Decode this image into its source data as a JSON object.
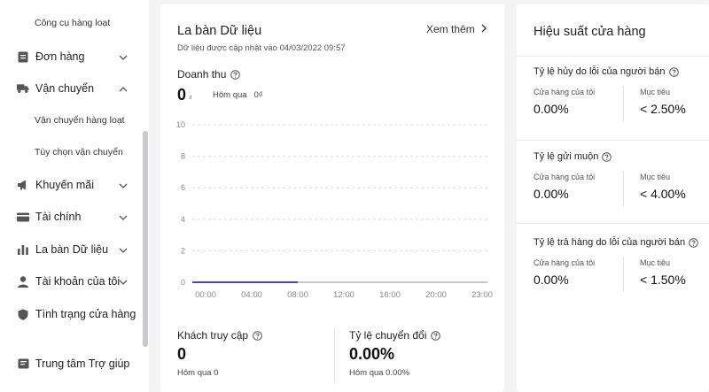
{
  "sidebar": {
    "items": [
      {
        "type": "sub",
        "label": "Công cụ hàng loạt"
      },
      {
        "type": "main",
        "label": "Đơn hàng",
        "icon": "order-icon",
        "chevron": "down"
      },
      {
        "type": "main",
        "label": "Vận chuyển",
        "icon": "truck-icon",
        "chevron": "up"
      },
      {
        "type": "sub",
        "label": "Vận chuyển hàng loạt"
      },
      {
        "type": "sub",
        "label": "Tùy chọn vận chuyển"
      },
      {
        "type": "main",
        "label": "Khuyến mãi",
        "icon": "megaphone-icon",
        "chevron": "down"
      },
      {
        "type": "main",
        "label": "Tài chính",
        "icon": "wallet-icon",
        "chevron": "down"
      },
      {
        "type": "main",
        "label": "La bàn Dữ liệu",
        "icon": "bar-chart-icon",
        "chevron": "down"
      },
      {
        "type": "main",
        "label": "Tài khoản của tôi",
        "icon": "user-icon",
        "chevron": "down"
      },
      {
        "type": "main",
        "label": "Tình trạng cửa hàng",
        "icon": "shield-icon"
      },
      {
        "type": "main",
        "label": "Trung tâm Trợ giúp",
        "icon": "help-center-icon"
      }
    ]
  },
  "data_compass": {
    "title": "La bàn Dữ liệu",
    "see_more": "Xem thêm",
    "updated": "Dữ liệu được cập nhật vào 04/03/2022 09:57",
    "revenue_label": "Doanh thu",
    "revenue_value": "0",
    "revenue_unit": "₫",
    "revenue_yesterday_label": "Hôm qua",
    "revenue_yesterday_value": "0₫",
    "visitors_label": "Khách truy cập",
    "visitors_value": "0",
    "visitors_prev": "Hôm qua 0",
    "conversion_label": "Tỷ lệ chuyển đổi",
    "conversion_value": "0.00%",
    "conversion_prev": "Hôm qua 0.00%"
  },
  "chart_data": {
    "type": "line",
    "x": [
      "00:00",
      "04:00",
      "08:00",
      "12:00",
      "16:00",
      "20:00",
      "23:00"
    ],
    "series": [
      {
        "values": [
          0,
          0,
          0
        ]
      }
    ],
    "series_x": [
      "00:00",
      "04:00",
      "08:00"
    ],
    "ylim": [
      0,
      10
    ],
    "yticks": [
      "0",
      "2",
      "4",
      "6",
      "8",
      "10"
    ],
    "grid": true,
    "colors": {
      "line": "#4a4aa8",
      "baseline": "#c8c8cc",
      "grid": "#dcdce0",
      "tick": "#888888"
    }
  },
  "shop_performance": {
    "title": "Hiệu suất cửa hàng",
    "metrics": [
      {
        "name": "Tỷ lệ hủy do lỗi của người bán",
        "my_label": "Cửa hàng của tôi",
        "my_value": "0.00%",
        "target_label": "Mục tiêu",
        "target_value": "< 2.50%"
      },
      {
        "name": "Tỷ lệ gửi muộn",
        "my_label": "Cửa hàng của tôi",
        "my_value": "0.00%",
        "target_label": "Mục tiêu",
        "target_value": "< 4.00%"
      },
      {
        "name": "Tỷ lệ trả hàng do lỗi của người bán",
        "my_label": "Cửa hàng của tôi",
        "my_value": "0.00%",
        "target_label": "Mục tiêu",
        "target_value": "< 1.50%"
      }
    ]
  }
}
